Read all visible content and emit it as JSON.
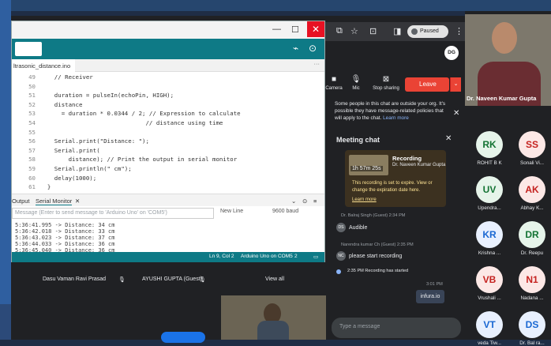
{
  "browser": {
    "paused_label": "Paused"
  },
  "ide": {
    "tab_name": "ltrasonic_distance.ino",
    "code_lines": [
      {
        "n": "49",
        "text": "    // Receiver"
      },
      {
        "n": "50",
        "text": ""
      },
      {
        "n": "51",
        "text": "    duration = pulseIn(echoPin, HIGH);"
      },
      {
        "n": "52",
        "text": "    distance"
      },
      {
        "n": "53",
        "text": "      = duration * 0.0344 / 2; // Expression to calculate"
      },
      {
        "n": "54",
        "text": "                              // distance using time"
      },
      {
        "n": "55",
        "text": ""
      },
      {
        "n": "56",
        "text": "    Serial.print(\"Distance: \");"
      },
      {
        "n": "57",
        "text": "    Serial.print("
      },
      {
        "n": "58",
        "text": "        distance); // Print the output in serial monitor"
      },
      {
        "n": "59",
        "text": "    Serial.println(\" cm\");"
      },
      {
        "n": "60",
        "text": "    delay(1000);"
      },
      {
        "n": "61",
        "text": "  }"
      }
    ],
    "output_tab": "Output",
    "serial_tab": "Serial Monitor",
    "serial_placeholder": "Message (Enter to send message to 'Arduino Uno' on 'COM5')",
    "line_ending": "New Line",
    "baud": "9600 baud",
    "serial_log": [
      "5:36:41.995 -> Distance: 34 cm",
      "5:36:42.018 -> Distance: 33 cm",
      "5:36:43.023 -> Distance: 37 cm",
      "5:36:44.033 -> Distance: 36 cm",
      "5:36:45.040 -> Distance: 36 cm"
    ],
    "status_position": "Ln 9, Col 2",
    "status_board": "Arduino Uno on COM5",
    "status_count": "2"
  },
  "meet": {
    "tiles_row": [
      {
        "name": "Dasu Vaman Ravi Prasad"
      },
      {
        "name": "AYUSHI GUPTA (Guest)"
      },
      {
        "name": "View all"
      }
    ],
    "controls": {
      "camera": "Camera",
      "mic": "Mic",
      "stop_sharing": "Stop sharing",
      "leave": "Leave"
    },
    "notice": "Some people in this chat are outside your org. It's possible they have message-related policies that will apply to the chat.",
    "notice_link": "Learn more",
    "chat_title": "Meeting chat",
    "recording": {
      "title": "Recording",
      "subtitle": "Dr. Naveen Kumar Gupta",
      "duration": "1h 57m 25s",
      "expire_text": "This recording is set to expire. View or change the expiration date here.",
      "learn_more": "Learn more"
    },
    "messages": [
      {
        "sender": "Dr. Balraj Singh (Guest)  2:34 PM",
        "initials": "DS",
        "text": "Audible"
      },
      {
        "sender": "Narendra kumar Ch (Guest)  2:35 PM",
        "initials": "NC",
        "text": "please start recording"
      }
    ],
    "recording_started": "2:35 PM  Recording has started",
    "my_message_time": "3:01 PM",
    "my_message": "infura.io",
    "input_placeholder": "Type a message",
    "self_initials": "DG",
    "speaker_name": "Dr. Naveen Kumar Gupta",
    "participants": [
      {
        "initials": "RK",
        "name": "ROHIT B K",
        "bg": "#e6f4ea",
        "fg": "#137333"
      },
      {
        "initials": "SS",
        "name": "Sonali Vi...",
        "bg": "#fce8e6",
        "fg": "#c5221f"
      },
      {
        "initials": "UV",
        "name": "Upendra...",
        "bg": "#e6f4ea",
        "fg": "#137333"
      },
      {
        "initials": "AK",
        "name": "Abhay K...",
        "bg": "#fce8e6",
        "fg": "#c5221f"
      },
      {
        "initials": "KR",
        "name": "Krishna ...",
        "bg": "#e8f0fe",
        "fg": "#1967d2"
      },
      {
        "initials": "DR",
        "name": "Dr. Reepu",
        "bg": "#e6f4ea",
        "fg": "#137333"
      },
      {
        "initials": "VB",
        "name": "Vrushali ...",
        "bg": "#fce8e6",
        "fg": "#c5221f"
      },
      {
        "initials": "N1",
        "name": "Nadana ...",
        "bg": "#fce8e6",
        "fg": "#c5221f"
      },
      {
        "initials": "VT",
        "name": "veda Tiw...",
        "bg": "#e8f0fe",
        "fg": "#1967d2"
      },
      {
        "initials": "DS",
        "name": "Dr. Bal ra...",
        "bg": "#e8f0fe",
        "fg": "#1967d2"
      }
    ]
  }
}
